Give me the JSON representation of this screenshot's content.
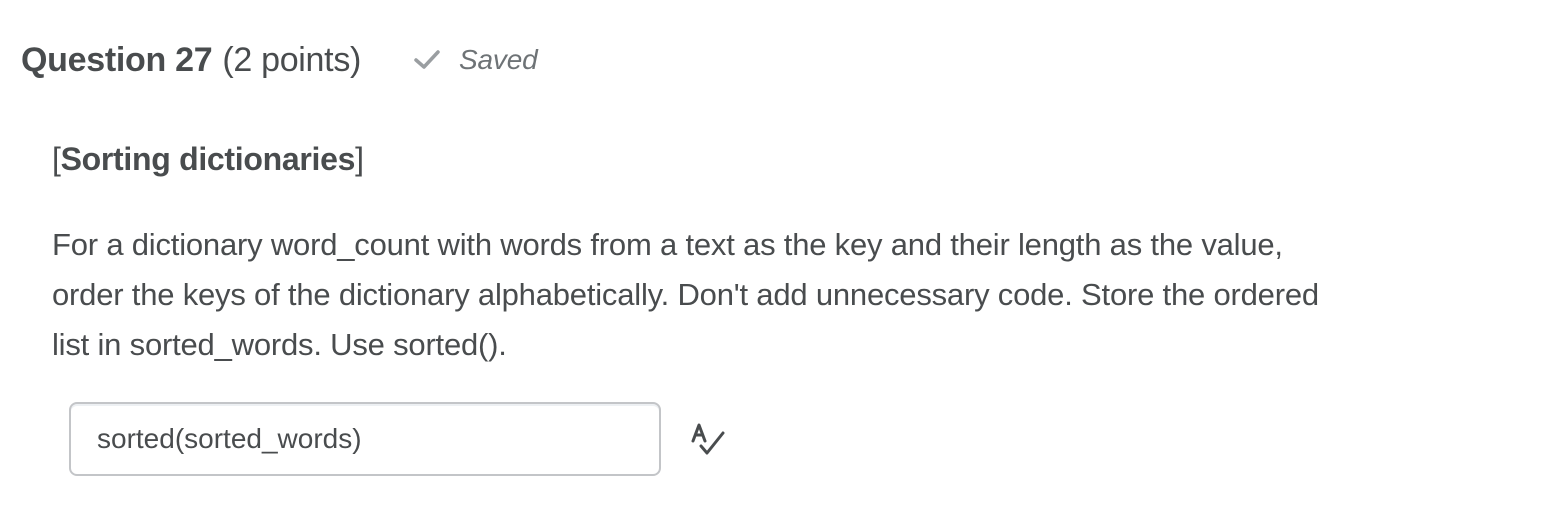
{
  "question": {
    "title": "Question 27",
    "points": "(2 points)",
    "status": {
      "label": "Saved",
      "icon": "check-icon",
      "color": "#9a9ea1"
    }
  },
  "body": {
    "topic": {
      "open_bracket": "[",
      "label": "Sorting dictionaries",
      "close_bracket": "]"
    },
    "lines": [
      "For a dictionary word_count with words from a text as the key and their length as the value,",
      "order the keys of the dictionary alphabetically. Don't add unnecessary code. Store the ordered",
      "list in sorted_words. Use sorted()."
    ]
  },
  "answer": {
    "value": "sorted(sorted_words)",
    "spellcheck_icon": "spellcheck-icon"
  }
}
